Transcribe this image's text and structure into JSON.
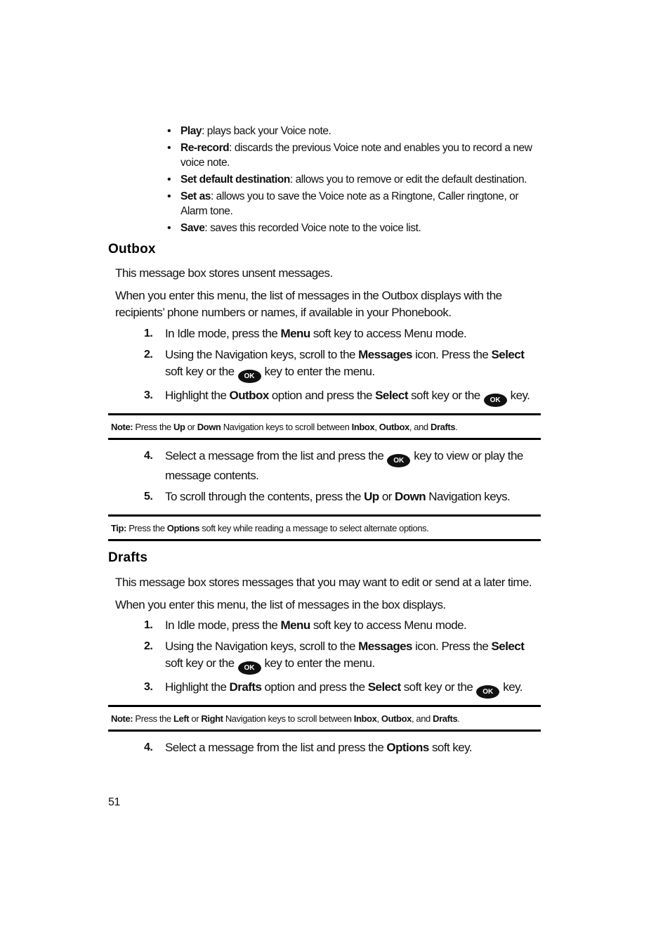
{
  "bullets": [
    [
      {
        "b": "Play"
      },
      {
        "t": ": plays back your Voice note."
      }
    ],
    [
      {
        "b": "Re-record"
      },
      {
        "t": ": discards the previous Voice note and enables you to record a new voice note."
      }
    ],
    [
      {
        "b": "Set default destination"
      },
      {
        "t": ": allows you to remove or edit the default destination."
      }
    ],
    [
      {
        "b": "Set as"
      },
      {
        "t": ": allows you to save the Voice note as a Ringtone, Caller ringtone, or Alarm tone."
      }
    ],
    [
      {
        "b": "Save"
      },
      {
        "t": ": saves this recorded Voice note to the voice list."
      }
    ]
  ],
  "bullet_glyph": "•",
  "ok_key_label": "OK",
  "outbox": {
    "heading": "Outbox",
    "intro": "This message box stores unsent messages.",
    "detail": "When you enter this menu, the list of messages in the Outbox displays with the recipients’ phone numbers or names, if available in your Phonebook.",
    "steps_a": [
      {
        "num": "1.",
        "segs": [
          {
            "t": "In Idle mode, press the "
          },
          {
            "b": "Menu"
          },
          {
            "t": " soft key to access Menu mode."
          }
        ]
      },
      {
        "num": "2.",
        "segs": [
          {
            "t": "Using the Navigation keys, scroll to the "
          },
          {
            "b": "Messages"
          },
          {
            "t": " icon. Press the "
          },
          {
            "b": "Select"
          },
          {
            "t": " soft key or the"
          },
          {
            "ok": true
          },
          {
            "t": "key to enter the menu."
          }
        ]
      },
      {
        "num": "3.",
        "segs": [
          {
            "t": "Highlight the "
          },
          {
            "b": "Outbox"
          },
          {
            "t": " option and press the "
          },
          {
            "b": "Select"
          },
          {
            "t": " soft key or the"
          },
          {
            "ok": true
          },
          {
            "t": "key."
          }
        ]
      }
    ],
    "note": [
      {
        "b": "Note:"
      },
      {
        "t": " Press the "
      },
      {
        "b": "Up"
      },
      {
        "t": " or "
      },
      {
        "b": "Down"
      },
      {
        "t": " Navigation keys to scroll between "
      },
      {
        "b": "Inbox"
      },
      {
        "t": ", "
      },
      {
        "b": "Outbox"
      },
      {
        "t": ", and "
      },
      {
        "b": "Drafts"
      },
      {
        "t": "."
      }
    ],
    "steps_b": [
      {
        "num": "4.",
        "segs": [
          {
            "t": "Select a message from the list and press the"
          },
          {
            "ok": true
          },
          {
            "t": "key to view or play the message contents."
          }
        ]
      },
      {
        "num": "5.",
        "segs": [
          {
            "t": "To scroll through the contents, press the "
          },
          {
            "b": "Up"
          },
          {
            "t": " or "
          },
          {
            "b": "Down"
          },
          {
            "t": " Navigation keys."
          }
        ]
      }
    ],
    "tip": [
      {
        "b": "Tip:"
      },
      {
        "t": " Press the "
      },
      {
        "b": "Options"
      },
      {
        "t": " soft key while reading a message to select alternate options."
      }
    ]
  },
  "drafts": {
    "heading": "Drafts",
    "intro": "This message box stores messages that you may want to edit or send at a later time.",
    "detail": "When you enter this menu, the list of messages in the box displays.",
    "steps_a": [
      {
        "num": "1.",
        "segs": [
          {
            "t": "In Idle mode, press the "
          },
          {
            "b": "Menu"
          },
          {
            "t": " soft key to access Menu mode."
          }
        ]
      },
      {
        "num": "2.",
        "segs": [
          {
            "t": "Using the Navigation keys, scroll to the "
          },
          {
            "b": "Messages"
          },
          {
            "t": " icon. Press the "
          },
          {
            "b": "Select"
          },
          {
            "t": " soft key or the"
          },
          {
            "ok": true
          },
          {
            "t": "key to enter the menu."
          }
        ]
      },
      {
        "num": "3.",
        "segs": [
          {
            "t": "Highlight the "
          },
          {
            "b": "Drafts"
          },
          {
            "t": " option and press the "
          },
          {
            "b": "Select"
          },
          {
            "t": " soft key or the"
          },
          {
            "ok": true
          },
          {
            "t": "key."
          }
        ]
      }
    ],
    "note": [
      {
        "b": "Note:"
      },
      {
        "t": " Press the "
      },
      {
        "b": "Left"
      },
      {
        "t": " or "
      },
      {
        "b": "Right"
      },
      {
        "t": " Navigation keys to scroll between "
      },
      {
        "b": "Inbox"
      },
      {
        "t": ", "
      },
      {
        "b": "Outbox"
      },
      {
        "t": ", and "
      },
      {
        "b": "Drafts"
      },
      {
        "t": "."
      }
    ],
    "steps_b": [
      {
        "num": "4.",
        "segs": [
          {
            "t": "Select a message from the list and press the "
          },
          {
            "b": "Options"
          },
          {
            "t": " soft key."
          }
        ]
      }
    ]
  },
  "page_number": "51"
}
